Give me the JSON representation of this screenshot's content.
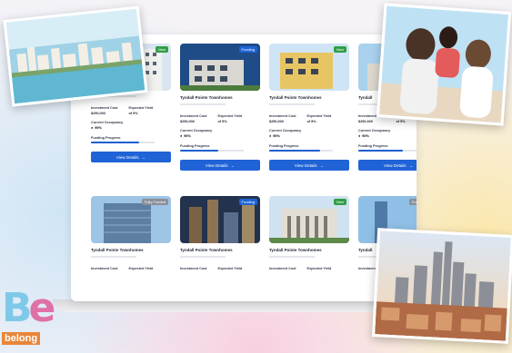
{
  "brand": {
    "logo_mark": "Be",
    "logo_word": "belong"
  },
  "cards": [
    {
      "title": "",
      "badge": "New",
      "badge_color": "#2f9e44",
      "price_label": "Investment Cost",
      "price": "$250,000",
      "yield_label": "Expected Yield",
      "yield": "of 5%",
      "occ_label": "Current Occupancy",
      "occ": "90%",
      "fp_label": "Funding Progress",
      "funded": 0.75,
      "button": "View Details",
      "scene": "tower"
    },
    {
      "title": "Tyndall Pointe Townhomes",
      "badge": "Funding",
      "badge_color": "#1f63d6",
      "price_label": "Investment Cost",
      "price": "$250,000",
      "yield_label": "Expected Yield",
      "yield": "of 5%",
      "occ_label": "Current Occupancy",
      "occ": "90%",
      "fp_label": "Funding Progress",
      "funded": 0.6,
      "button": "View Details",
      "scene": "apartment"
    },
    {
      "title": "Tyndall Pointe Townhomes",
      "badge": "New",
      "badge_color": "#2f9e44",
      "price_label": "Investment Cost",
      "price": "$250,000",
      "yield_label": "Expected Yield",
      "yield": "of 5%",
      "occ_label": "Current Occupancy",
      "occ": "90%",
      "fp_label": "Funding Progress",
      "funded": 0.8,
      "button": "View Details",
      "scene": "yellow"
    },
    {
      "title": "Tyndall",
      "badge": "",
      "badge_color": "#2f9e44",
      "price_label": "Investment Cost",
      "price": "$250,000",
      "yield_label": "Expected Yield",
      "yield": "of 5%",
      "occ_label": "Current Occupancy",
      "occ": "90%",
      "fp_label": "Funding Progress",
      "funded": 0.7,
      "button": "View Details",
      "scene": "sky"
    },
    {
      "title": "Tyndall Pointe Townhomes",
      "badge": "Fully Funded",
      "badge_color": "#8a8f99",
      "price_label": "Investment Cost",
      "price": "",
      "yield_label": "Expected Yield",
      "yield": "",
      "occ_label": "",
      "occ": "",
      "fp_label": "",
      "funded": 0,
      "button": "",
      "scene": "glass"
    },
    {
      "title": "Tyndall Pointe Townhomes",
      "badge": "Funding",
      "badge_color": "#1f63d6",
      "price_label": "Investment Cost",
      "price": "",
      "yield_label": "Expected Yield",
      "yield": "",
      "occ_label": "",
      "occ": "",
      "fp_label": "",
      "funded": 0,
      "button": "",
      "scene": "night"
    },
    {
      "title": "Tyndall Pointe Townhomes",
      "badge": "New",
      "badge_color": "#2f9e44",
      "price_label": "Investment Cost",
      "price": "",
      "yield_label": "Expected Yield",
      "yield": "",
      "occ_label": "",
      "occ": "",
      "fp_label": "",
      "funded": 0,
      "button": "",
      "scene": "classic"
    },
    {
      "title": "Tyndall",
      "badge": "Fully Funded",
      "badge_color": "#8a8f99",
      "price_label": "Investment Cost",
      "price": "",
      "yield_label": "",
      "yield": "",
      "occ_label": "",
      "occ": "",
      "fp_label": "",
      "funded": 0,
      "button": "",
      "scene": "blue"
    }
  ]
}
